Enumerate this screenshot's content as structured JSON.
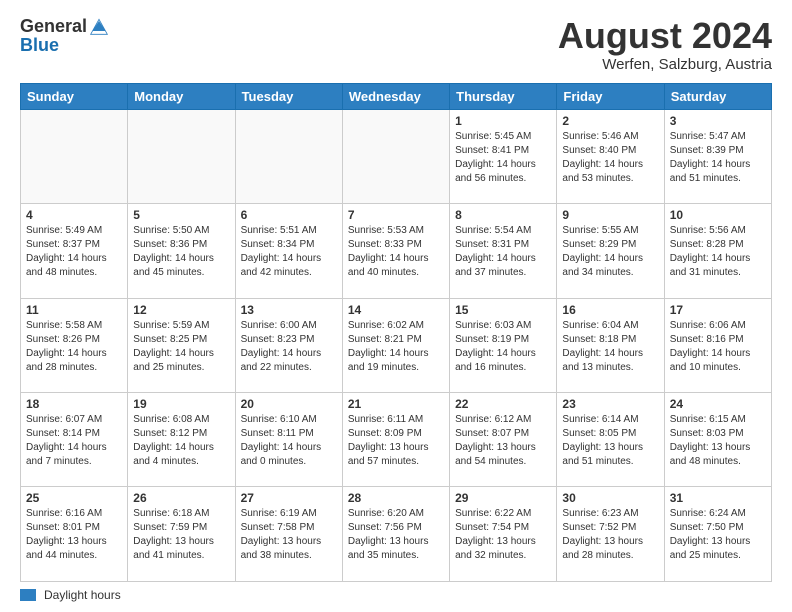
{
  "header": {
    "logo_general": "General",
    "logo_blue": "Blue",
    "title": "August 2024",
    "location": "Werfen, Salzburg, Austria"
  },
  "days_of_week": [
    "Sunday",
    "Monday",
    "Tuesday",
    "Wednesday",
    "Thursday",
    "Friday",
    "Saturday"
  ],
  "weeks": [
    [
      {
        "day": "",
        "info": ""
      },
      {
        "day": "",
        "info": ""
      },
      {
        "day": "",
        "info": ""
      },
      {
        "day": "",
        "info": ""
      },
      {
        "day": "1",
        "info": "Sunrise: 5:45 AM\nSunset: 8:41 PM\nDaylight: 14 hours\nand 56 minutes."
      },
      {
        "day": "2",
        "info": "Sunrise: 5:46 AM\nSunset: 8:40 PM\nDaylight: 14 hours\nand 53 minutes."
      },
      {
        "day": "3",
        "info": "Sunrise: 5:47 AM\nSunset: 8:39 PM\nDaylight: 14 hours\nand 51 minutes."
      }
    ],
    [
      {
        "day": "4",
        "info": "Sunrise: 5:49 AM\nSunset: 8:37 PM\nDaylight: 14 hours\nand 48 minutes."
      },
      {
        "day": "5",
        "info": "Sunrise: 5:50 AM\nSunset: 8:36 PM\nDaylight: 14 hours\nand 45 minutes."
      },
      {
        "day": "6",
        "info": "Sunrise: 5:51 AM\nSunset: 8:34 PM\nDaylight: 14 hours\nand 42 minutes."
      },
      {
        "day": "7",
        "info": "Sunrise: 5:53 AM\nSunset: 8:33 PM\nDaylight: 14 hours\nand 40 minutes."
      },
      {
        "day": "8",
        "info": "Sunrise: 5:54 AM\nSunset: 8:31 PM\nDaylight: 14 hours\nand 37 minutes."
      },
      {
        "day": "9",
        "info": "Sunrise: 5:55 AM\nSunset: 8:29 PM\nDaylight: 14 hours\nand 34 minutes."
      },
      {
        "day": "10",
        "info": "Sunrise: 5:56 AM\nSunset: 8:28 PM\nDaylight: 14 hours\nand 31 minutes."
      }
    ],
    [
      {
        "day": "11",
        "info": "Sunrise: 5:58 AM\nSunset: 8:26 PM\nDaylight: 14 hours\nand 28 minutes."
      },
      {
        "day": "12",
        "info": "Sunrise: 5:59 AM\nSunset: 8:25 PM\nDaylight: 14 hours\nand 25 minutes."
      },
      {
        "day": "13",
        "info": "Sunrise: 6:00 AM\nSunset: 8:23 PM\nDaylight: 14 hours\nand 22 minutes."
      },
      {
        "day": "14",
        "info": "Sunrise: 6:02 AM\nSunset: 8:21 PM\nDaylight: 14 hours\nand 19 minutes."
      },
      {
        "day": "15",
        "info": "Sunrise: 6:03 AM\nSunset: 8:19 PM\nDaylight: 14 hours\nand 16 minutes."
      },
      {
        "day": "16",
        "info": "Sunrise: 6:04 AM\nSunset: 8:18 PM\nDaylight: 14 hours\nand 13 minutes."
      },
      {
        "day": "17",
        "info": "Sunrise: 6:06 AM\nSunset: 8:16 PM\nDaylight: 14 hours\nand 10 minutes."
      }
    ],
    [
      {
        "day": "18",
        "info": "Sunrise: 6:07 AM\nSunset: 8:14 PM\nDaylight: 14 hours\nand 7 minutes."
      },
      {
        "day": "19",
        "info": "Sunrise: 6:08 AM\nSunset: 8:12 PM\nDaylight: 14 hours\nand 4 minutes."
      },
      {
        "day": "20",
        "info": "Sunrise: 6:10 AM\nSunset: 8:11 PM\nDaylight: 14 hours and 0 minutes."
      },
      {
        "day": "21",
        "info": "Sunrise: 6:11 AM\nSunset: 8:09 PM\nDaylight: 13 hours\nand 57 minutes."
      },
      {
        "day": "22",
        "info": "Sunrise: 6:12 AM\nSunset: 8:07 PM\nDaylight: 13 hours\nand 54 minutes."
      },
      {
        "day": "23",
        "info": "Sunrise: 6:14 AM\nSunset: 8:05 PM\nDaylight: 13 hours\nand 51 minutes."
      },
      {
        "day": "24",
        "info": "Sunrise: 6:15 AM\nSunset: 8:03 PM\nDaylight: 13 hours\nand 48 minutes."
      }
    ],
    [
      {
        "day": "25",
        "info": "Sunrise: 6:16 AM\nSunset: 8:01 PM\nDaylight: 13 hours\nand 44 minutes."
      },
      {
        "day": "26",
        "info": "Sunrise: 6:18 AM\nSunset: 7:59 PM\nDaylight: 13 hours\nand 41 minutes."
      },
      {
        "day": "27",
        "info": "Sunrise: 6:19 AM\nSunset: 7:58 PM\nDaylight: 13 hours\nand 38 minutes."
      },
      {
        "day": "28",
        "info": "Sunrise: 6:20 AM\nSunset: 7:56 PM\nDaylight: 13 hours\nand 35 minutes."
      },
      {
        "day": "29",
        "info": "Sunrise: 6:22 AM\nSunset: 7:54 PM\nDaylight: 13 hours\nand 32 minutes."
      },
      {
        "day": "30",
        "info": "Sunrise: 6:23 AM\nSunset: 7:52 PM\nDaylight: 13 hours\nand 28 minutes."
      },
      {
        "day": "31",
        "info": "Sunrise: 6:24 AM\nSunset: 7:50 PM\nDaylight: 13 hours\nand 25 minutes."
      }
    ]
  ],
  "footer": {
    "legend_label": "Daylight hours"
  }
}
